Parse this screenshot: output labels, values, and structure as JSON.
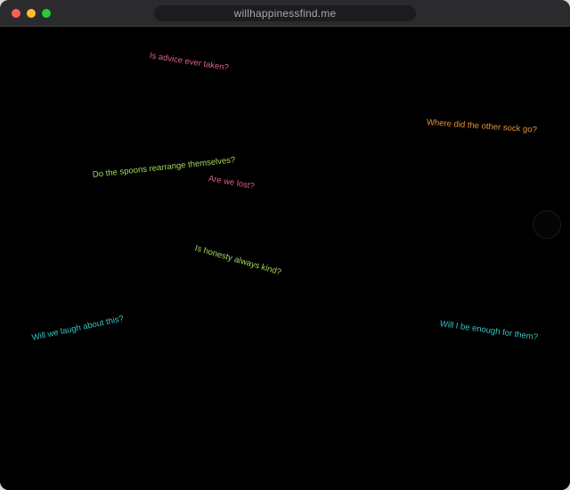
{
  "browser": {
    "url": "willhappinessfind.me",
    "traffic_lights": {
      "close": "#fe5f57",
      "minimize": "#febc2e",
      "maximize": "#28c840"
    }
  },
  "questions": [
    {
      "text": "Is advice ever taken?",
      "color": "#d9628c"
    },
    {
      "text": "Where did the other sock go?",
      "color": "#e8952c"
    },
    {
      "text": "Do the spoons rearrange themselves?",
      "color": "#a5d85a"
    },
    {
      "text": "Are we lost?",
      "color": "#d9628c"
    },
    {
      "text": "Is honesty always kind?",
      "color": "#a5d85a"
    },
    {
      "text": "Will we laugh about this?",
      "color": "#38c4c4"
    },
    {
      "text": "Will I be enough for them?",
      "color": "#38c4c4"
    }
  ]
}
